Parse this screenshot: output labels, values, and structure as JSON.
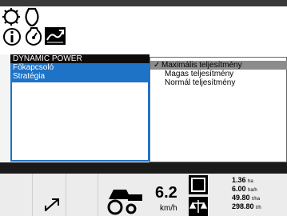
{
  "menu": {
    "items": [
      {
        "label": "DYNAMIC POWER"
      },
      {
        "label": "Főkapcsoló"
      },
      {
        "label": "Stratégia"
      }
    ]
  },
  "dropdown": {
    "items": [
      {
        "label": "Maximális teljesítmény",
        "checked": true
      },
      {
        "label": "Magas teljesítmény",
        "checked": false
      },
      {
        "label": "Normál teljesítmény",
        "checked": false
      }
    ],
    "check_mark": "✓"
  },
  "status": {
    "speed_value": "6.2",
    "speed_unit": "km/h",
    "readings": [
      {
        "value": "1.36",
        "unit": "ha"
      },
      {
        "value": "6.00",
        "unit": "ha/h"
      },
      {
        "value": "49.80",
        "unit": "t/ha"
      },
      {
        "value": "298.80",
        "unit": "t/h"
      }
    ]
  },
  "colors": {
    "menu_black": "#0c0c0c",
    "menu_blue": "#1e73c7",
    "selection_grey": "#8c8c8c"
  },
  "icons": [
    "tractor-icon",
    "engine-icon",
    "info-icon",
    "gauge-icon",
    "dynamic-power-icon",
    "arrow-icon",
    "harvester-icon",
    "area-frame-icon",
    "scale-icon"
  ]
}
